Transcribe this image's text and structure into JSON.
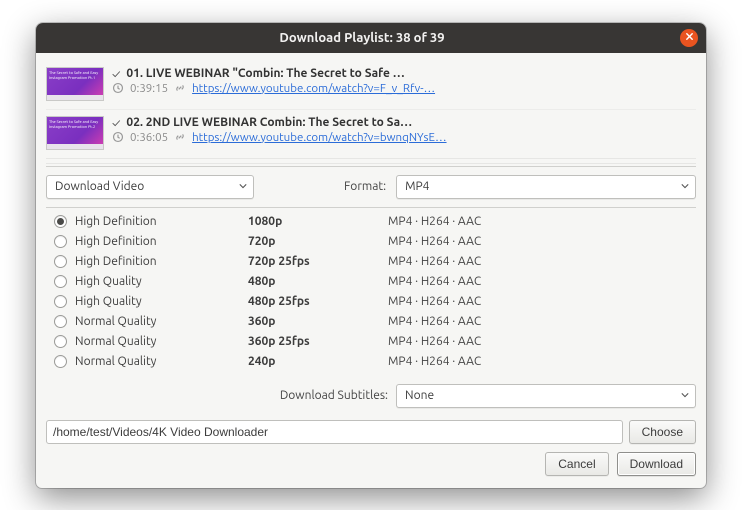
{
  "window": {
    "title": "Download Playlist: 38 of 39"
  },
  "playlist": {
    "items": [
      {
        "title": "01. LIVE WEBINAR \"Combin: The Secret to Safe …",
        "duration": "0:39:15",
        "url": "https://www.youtube.com/watch?v=F_v_Rfv-…",
        "thumb_text": "The Secret to Safe and Easy Instagram Promotion Pt.1"
      },
      {
        "title": "02. 2ND LIVE WEBINAR Combin: The Secret to Sa…",
        "duration": "0:36:05",
        "url": "https://www.youtube.com/watch?v=bwnqNYsE…",
        "thumb_text": "The Secret to Safe and Easy Instagram Promotion Pt.2"
      }
    ]
  },
  "action_selector": {
    "label": "Download Video"
  },
  "format": {
    "label": "Format:",
    "value": "MP4"
  },
  "quality": {
    "selected": 0,
    "rows": [
      {
        "quality": "High Definition",
        "res": "1080p",
        "codec": "MP4 · H264 · AAC"
      },
      {
        "quality": "High Definition",
        "res": "720p",
        "codec": "MP4 · H264 · AAC"
      },
      {
        "quality": "High Definition",
        "res": "720p 25fps",
        "codec": "MP4 · H264 · AAC"
      },
      {
        "quality": "High Quality",
        "res": "480p",
        "codec": "MP4 · H264 · AAC"
      },
      {
        "quality": "High Quality",
        "res": "480p 25fps",
        "codec": "MP4 · H264 · AAC"
      },
      {
        "quality": "Normal Quality",
        "res": "360p",
        "codec": "MP4 · H264 · AAC"
      },
      {
        "quality": "Normal Quality",
        "res": "360p 25fps",
        "codec": "MP4 · H264 · AAC"
      },
      {
        "quality": "Normal Quality",
        "res": "240p",
        "codec": "MP4 · H264 · AAC"
      }
    ]
  },
  "subtitles": {
    "label": "Download Subtitles:",
    "value": "None"
  },
  "path": {
    "value": "/home/test/Videos/4K Video Downloader",
    "choose_label": "Choose"
  },
  "footer": {
    "cancel": "Cancel",
    "download": "Download"
  }
}
